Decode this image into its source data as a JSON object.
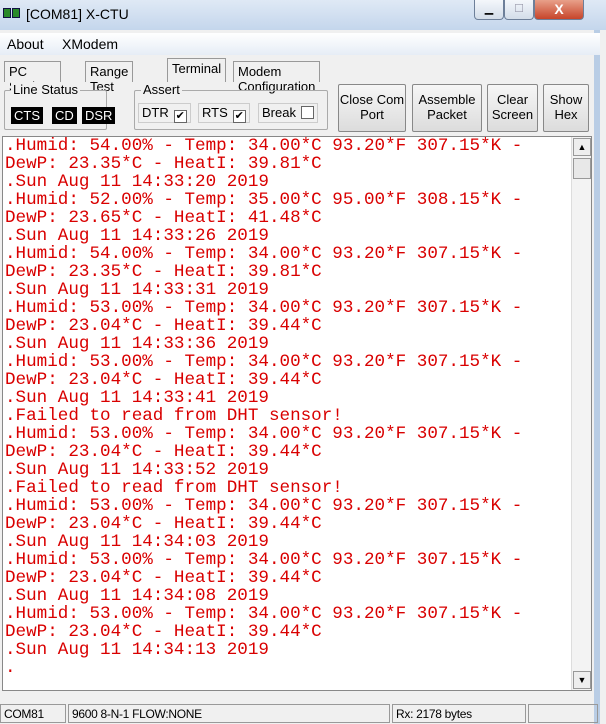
{
  "window": {
    "title": "[COM81] X-CTU",
    "close_glyph": "X"
  },
  "menu": [
    "About",
    "XModem"
  ],
  "tabs": [
    {
      "label": "PC Settings"
    },
    {
      "label": "Range Test"
    },
    {
      "label": "Terminal",
      "active": true
    },
    {
      "label": "Modem Configuration"
    }
  ],
  "line_status": {
    "label": "Line Status",
    "leds": [
      "CTS",
      "CD",
      "DSR"
    ]
  },
  "assert": {
    "label": "Assert",
    "items": [
      {
        "label": "DTR",
        "checked": true
      },
      {
        "label": "RTS",
        "checked": true
      },
      {
        "label": "Break",
        "checked": false
      }
    ]
  },
  "buttons": [
    {
      "label": "Close Com Port"
    },
    {
      "label": "Assemble Packet"
    },
    {
      "label": "Clear Screen"
    },
    {
      "label": "Show Hex"
    }
  ],
  "terminal": {
    "text_color": "#d90000",
    "lines": [
      ".Humid: 54.00% - Temp: 34.00*C 93.20*F 307.15*K -",
      "DewP: 23.35*C - HeatI: 39.81*C",
      ".Sun Aug 11 14:33:20 2019",
      ".Humid: 52.00% - Temp: 35.00*C 95.00*F 308.15*K -",
      "DewP: 23.65*C - HeatI: 41.48*C",
      ".Sun Aug 11 14:33:26 2019",
      ".Humid: 54.00% - Temp: 34.00*C 93.20*F 307.15*K -",
      "DewP: 23.35*C - HeatI: 39.81*C",
      ".Sun Aug 11 14:33:31 2019",
      ".Humid: 53.00% - Temp: 34.00*C 93.20*F 307.15*K -",
      "DewP: 23.04*C - HeatI: 39.44*C",
      ".Sun Aug 11 14:33:36 2019",
      ".Humid: 53.00% - Temp: 34.00*C 93.20*F 307.15*K -",
      "DewP: 23.04*C - HeatI: 39.44*C",
      ".Sun Aug 11 14:33:41 2019",
      ".Failed to read from DHT sensor!",
      ".Humid: 53.00% - Temp: 34.00*C 93.20*F 307.15*K -",
      "DewP: 23.04*C - HeatI: 39.44*C",
      ".Sun Aug 11 14:33:52 2019",
      ".Failed to read from DHT sensor!",
      ".Humid: 53.00% - Temp: 34.00*C 93.20*F 307.15*K -",
      "DewP: 23.04*C - HeatI: 39.44*C",
      ".Sun Aug 11 14:34:03 2019",
      ".Humid: 53.00% - Temp: 34.00*C 93.20*F 307.15*K -",
      "DewP: 23.04*C - HeatI: 39.44*C",
      ".Sun Aug 11 14:34:08 2019",
      ".Humid: 53.00% - Temp: 34.00*C 93.20*F 307.15*K -",
      "DewP: 23.04*C - HeatI: 39.44*C",
      ".Sun Aug 11 14:34:13 2019",
      "."
    ]
  },
  "status": {
    "port": "COM81",
    "settings": "9600 8-N-1  FLOW:NONE",
    "rx": "Rx: 2178 bytes",
    "extra": ""
  }
}
